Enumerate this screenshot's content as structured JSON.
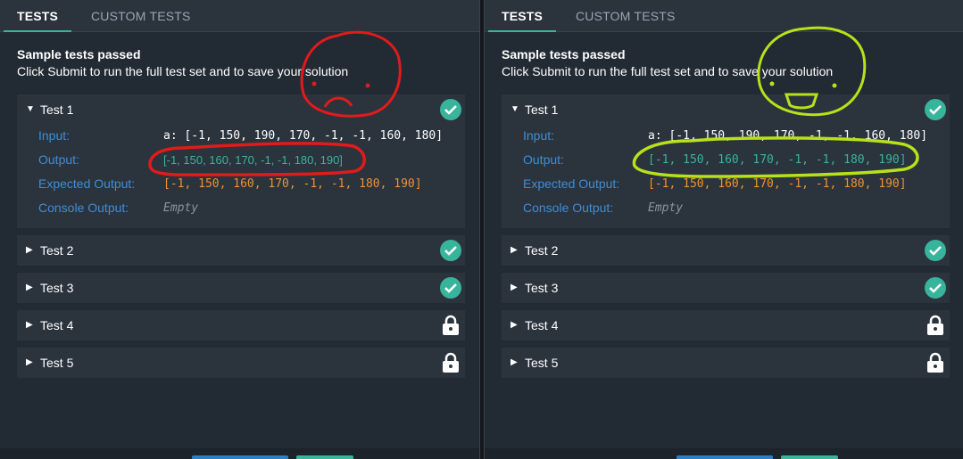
{
  "panels": [
    {
      "tabs": {
        "tests": "TESTS",
        "custom": "CUSTOM TESTS"
      },
      "status": {
        "title": "Sample tests passed",
        "subtitle": "Click Submit to run the full test set and to save your solution"
      },
      "tests": [
        {
          "label": "Test 1",
          "state": "passed",
          "expanded": true
        },
        {
          "label": "Test 2",
          "state": "passed"
        },
        {
          "label": "Test 3",
          "state": "passed"
        },
        {
          "label": "Test 4",
          "state": "locked"
        },
        {
          "label": "Test 5",
          "state": "locked"
        }
      ],
      "details": {
        "input_label": "Input:",
        "input_value": "a: [-1, 150, 190, 170, -1, -1, 160, 180]",
        "output_label": "Output:",
        "output_value": "[-1, 150, 160, 170, -1, -1, 180, 190]",
        "expected_label": "Expected Output:",
        "expected_value": "[-1, 150, 160, 170, -1, -1, 180, 190]",
        "console_label": "Console Output:",
        "console_value": "Empty"
      },
      "annotation": {
        "color": "#e11b1b",
        "face": "frown"
      }
    },
    {
      "tabs": {
        "tests": "TESTS",
        "custom": "CUSTOM TESTS"
      },
      "status": {
        "title": "Sample tests passed",
        "subtitle": "Click Submit to run the full test set and to save your solution"
      },
      "tests": [
        {
          "label": "Test 1",
          "state": "passed",
          "expanded": true
        },
        {
          "label": "Test 2",
          "state": "passed"
        },
        {
          "label": "Test 3",
          "state": "passed"
        },
        {
          "label": "Test 4",
          "state": "locked"
        },
        {
          "label": "Test 5",
          "state": "locked"
        }
      ],
      "details": {
        "input_label": "Input:",
        "input_value": "a: [-1, 150, 190, 170, -1, -1, 160, 180]",
        "output_label": "Output:",
        "output_value": "[-1, 150, 160, 170, -1, -1, 180, 190]",
        "expected_label": "Expected Output:",
        "expected_value": "[-1, 150, 160, 170, -1, -1, 180, 190]",
        "console_label": "Console Output:",
        "console_value": "Empty"
      },
      "annotation": {
        "color": "#b7e21a",
        "face": "smile"
      }
    }
  ],
  "colors": {
    "accent": "#39b49c",
    "label_blue": "#3e8ed6",
    "expected_orange": "#f0922f",
    "card_bg": "#2b333d",
    "panel_bg": "#222a33"
  },
  "icons": {
    "passed": "check-circle-icon",
    "locked": "lock-icon",
    "collapsed": "caret-right-icon",
    "expanded": "caret-down-icon"
  }
}
